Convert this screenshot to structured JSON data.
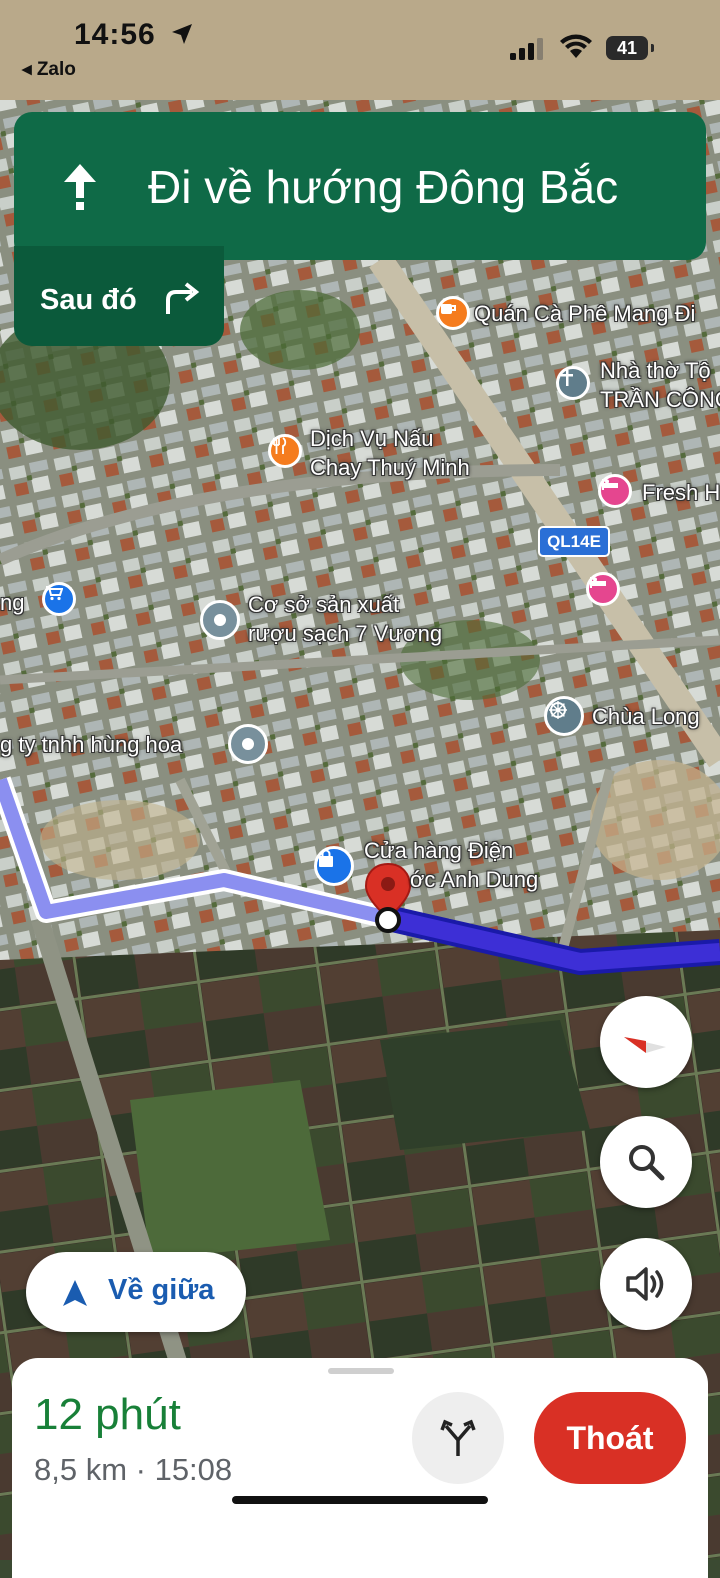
{
  "status_bar": {
    "time": "14:56",
    "back_app": "Zalo",
    "battery": "41"
  },
  "navigation": {
    "instruction": "Đi về hướng Đông Bắc",
    "then_label": "Sau đó"
  },
  "map": {
    "route_shield": "QL14E",
    "pois": [
      {
        "name": "Quán Cà Phê Mang Đi",
        "icon": "coffee-icon",
        "color": "#f57c1e"
      },
      {
        "name_line1": "Nhà thờ Tộ",
        "name_line2": "TRẦN CÔNG",
        "icon": "church-icon",
        "color": "#607d8b"
      },
      {
        "name_line1": "Dịch Vụ Nấu",
        "name_line2": "Chay Thuý Minh",
        "icon": "restaurant-icon",
        "color": "#f57c1e"
      },
      {
        "name": "Fresh H",
        "icon": "hotel-icon",
        "color": "#e5468f"
      },
      {
        "name": "",
        "icon": "hotel-icon",
        "color": "#e5468f"
      },
      {
        "name": "ng",
        "icon": "shopping-cart-icon",
        "color": "#1a73e8"
      },
      {
        "name_line1": "Cơ sở sản xuất",
        "name_line2": "rượu sạch 7 Vương",
        "icon": "place-icon",
        "color": "#78909c"
      },
      {
        "name": "Chùa Long",
        "icon": "dharma-wheel-icon",
        "color": "#607d8b"
      },
      {
        "name": "g ty tnhh hùng hoa",
        "icon": "place-icon",
        "color": "#78909c"
      },
      {
        "name_line1": "Cửa hàng Điện",
        "name_line2": "ớc Anh Dung",
        "icon": "shopping-bag-icon",
        "color": "#1a73e8"
      }
    ]
  },
  "controls": {
    "recenter_label": "Về giữa"
  },
  "bottom_sheet": {
    "duration": "12 phút",
    "details": "8,5 km · 15:08",
    "exit_label": "Thoát"
  },
  "colors": {
    "banner": "#0f6a47",
    "route": "#3d2fd6",
    "exit": "#d93025",
    "eta": "#188038"
  }
}
